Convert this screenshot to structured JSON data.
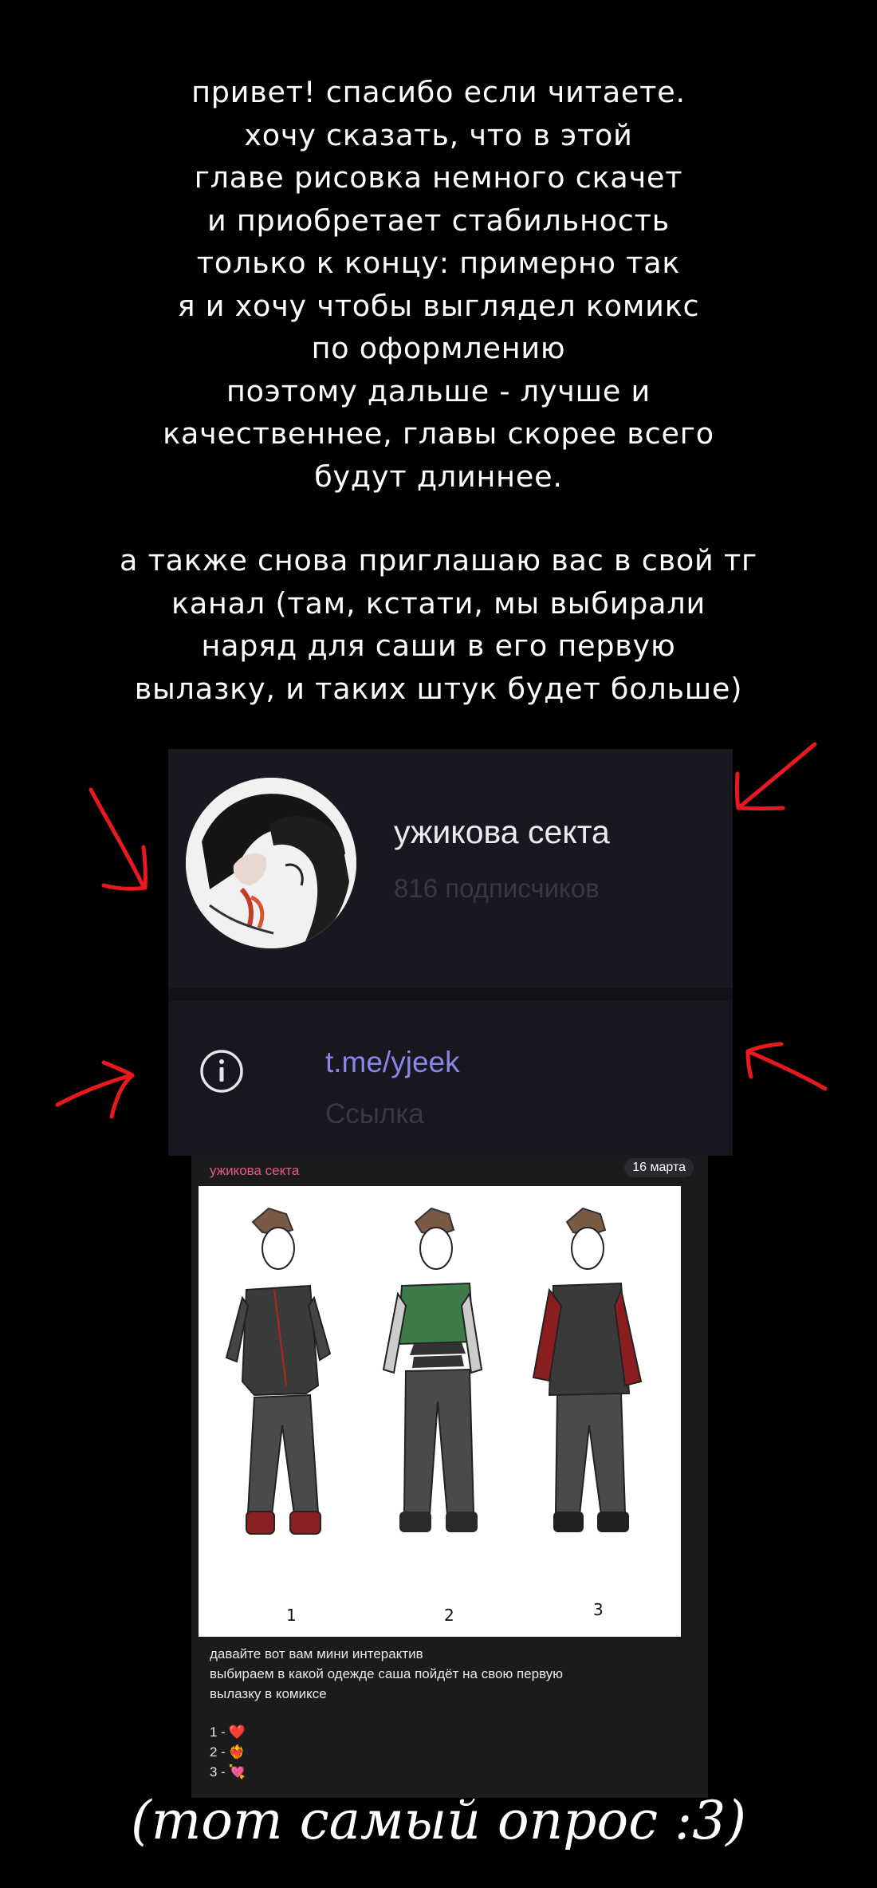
{
  "note": {
    "paragraph_1": [
      "привет! спасибо если читаете.",
      "хочу сказать, что в этой",
      "главе рисовка немного скачет",
      "и приобретает стабильность",
      "только к концу: примерно так",
      "я и хочу чтобы выглядел комикс",
      "по оформлению",
      "поэтому дальше - лучше и",
      "качественнее, главы скорее всего",
      "будут длиннее."
    ],
    "paragraph_2": [
      "а также снова приглашаю вас в свой тг",
      "канал (там, кстати, мы выбирали",
      "наряд для саши в его первую",
      "вылазку, и таких штук будет больше)"
    ]
  },
  "channel": {
    "name": "ужикова секта",
    "subscribers": "816 подписчиков",
    "link": "t.me/yjeek",
    "link_caption": "Ссылка"
  },
  "post": {
    "channel": "ужикова секта",
    "date": "16 марта",
    "figure_labels": [
      "1",
      "2",
      "3"
    ],
    "text_lines": [
      "давайте вот вам мини интерактив",
      "выбираем в какой одежде саша пойдёт на свою первую",
      "вылазку в комиксе"
    ],
    "poll": [
      {
        "label": "1 -",
        "emoji": "❤️"
      },
      {
        "label": "2 -",
        "emoji": "❤️‍🔥"
      },
      {
        "label": "3 -",
        "emoji": "💘"
      }
    ]
  },
  "handwritten_caption": "(тот самый опрос :3)",
  "colors": {
    "background": "#000000",
    "arrows": "#e8191e",
    "link": "#8c85e8",
    "post_channel": "#e35c84"
  }
}
